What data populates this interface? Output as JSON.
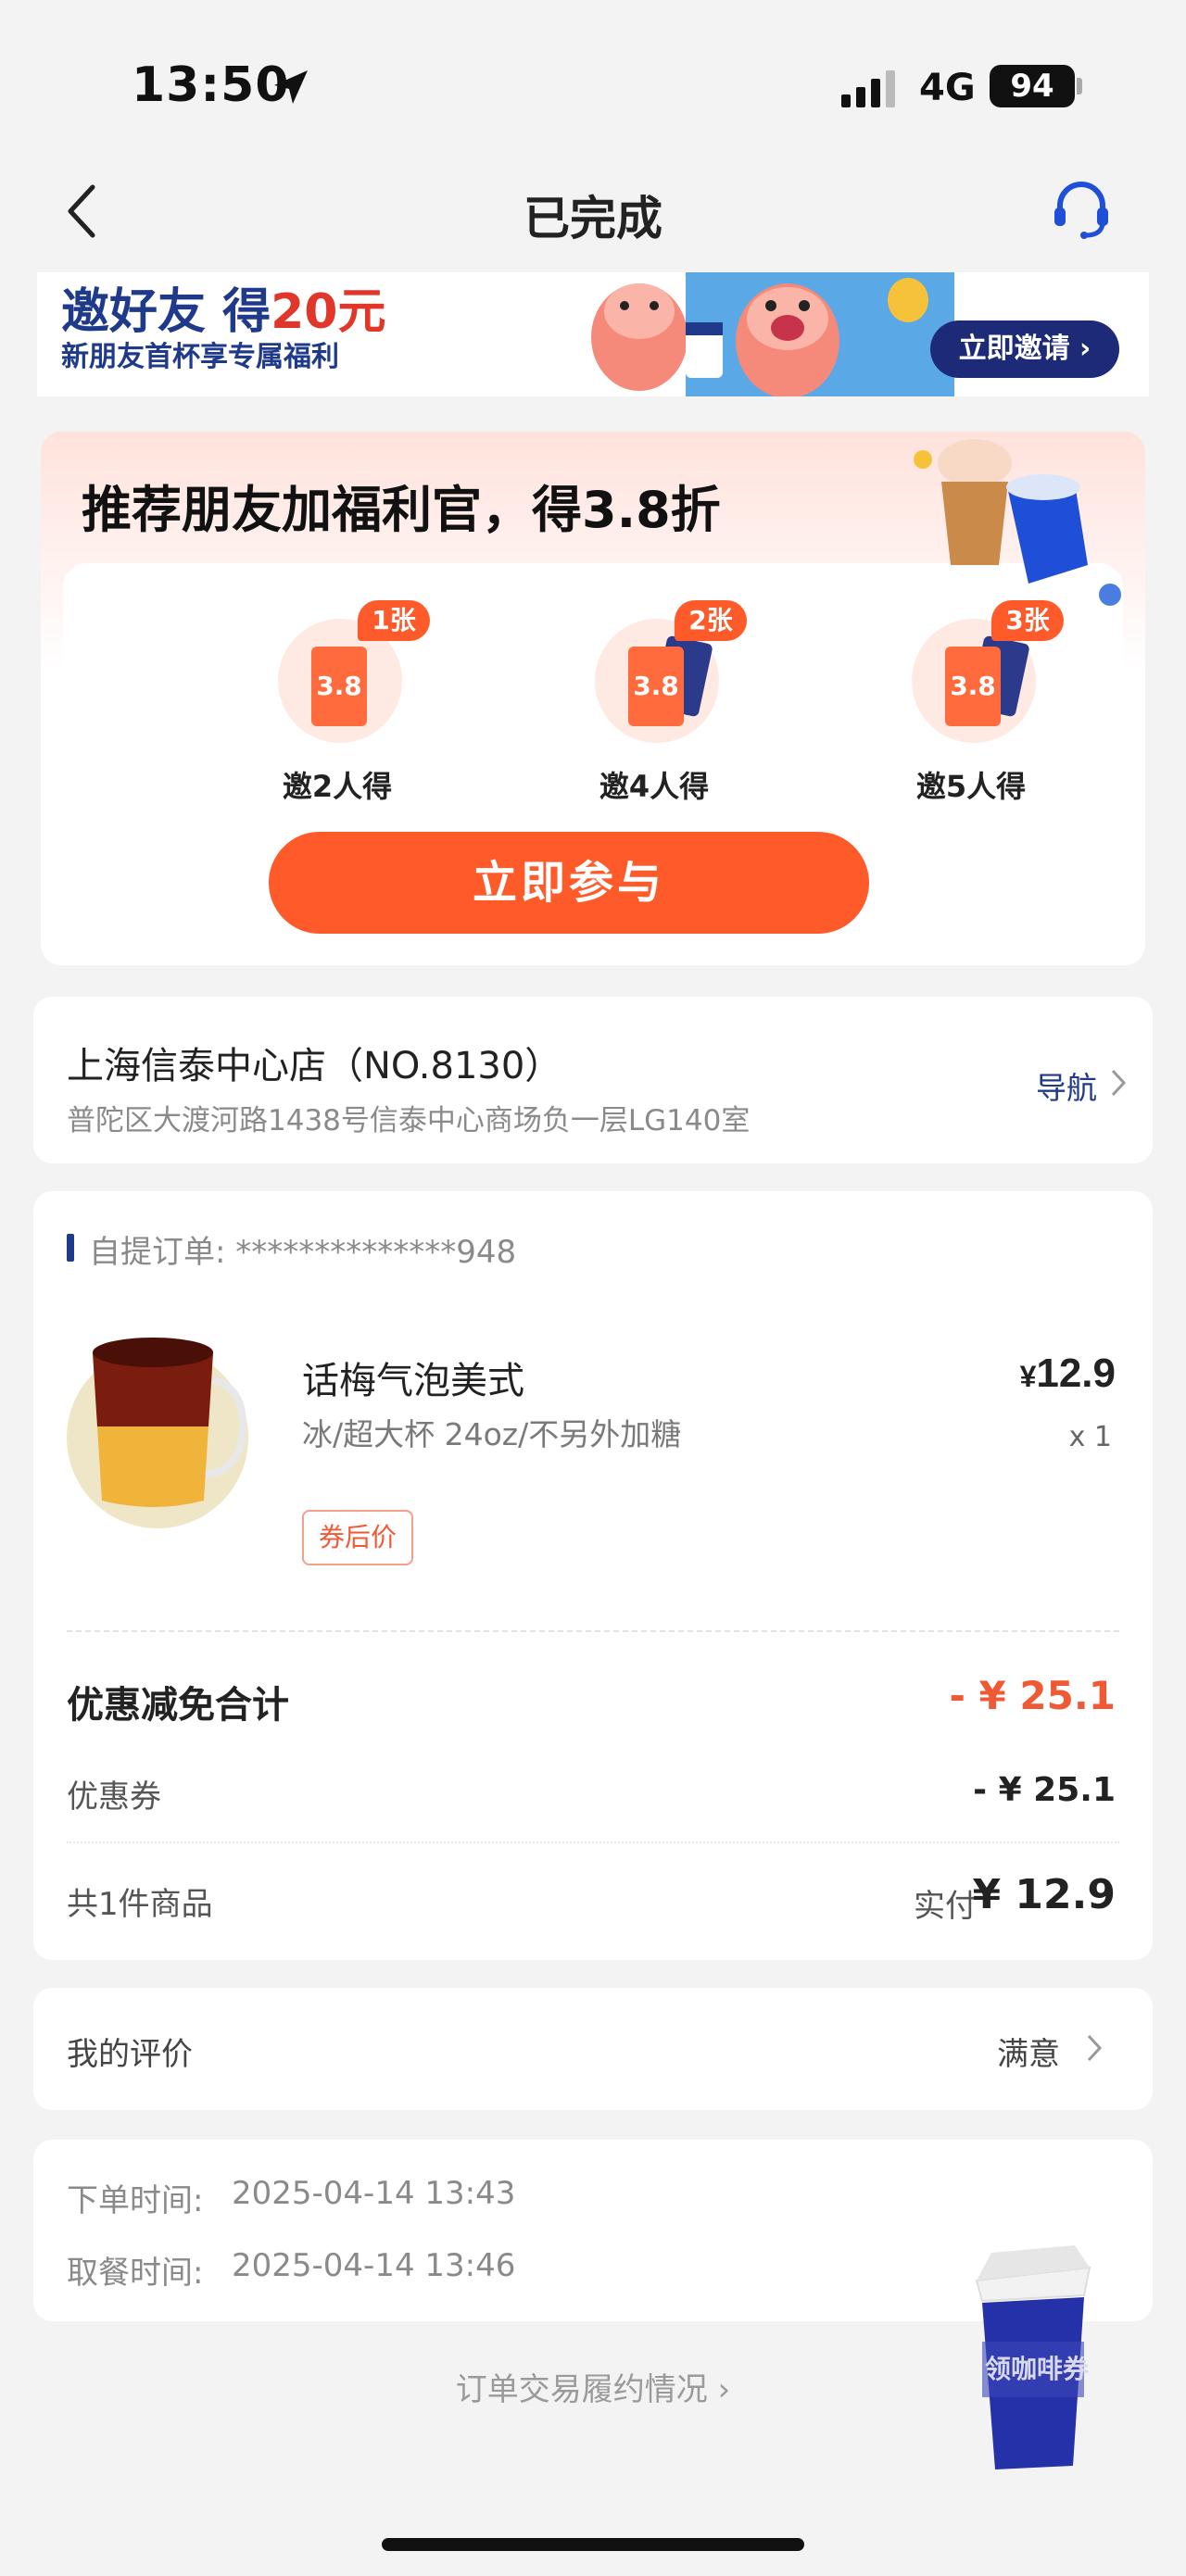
{
  "status_bar": {
    "time": "13:50",
    "network": "4G",
    "battery": "94"
  },
  "nav": {
    "title": "已完成"
  },
  "top_banner": {
    "headline_prefix": "邀好友 得",
    "headline_amount": "20元",
    "subtitle": "新朋友首杯享专属福利",
    "button": "立即邀请"
  },
  "referral": {
    "title": "推荐朋友加福利官，得3.8折",
    "ticket_value": "3.8",
    "tiers": [
      {
        "badge": "1张",
        "label": "邀2人得"
      },
      {
        "badge": "2张",
        "label": "邀4人得"
      },
      {
        "badge": "3张",
        "label": "邀5人得"
      }
    ],
    "button": "立即参与"
  },
  "store": {
    "name": "上海信泰中心店（NO.8130）",
    "address": "普陀区大渡河路1438号信泰中心商场负一层LG140室",
    "nav_link": "导航"
  },
  "order": {
    "label": "自提订单: **************948",
    "product": {
      "name": "话梅气泡美式",
      "options": "冰/超大杯 24oz/不另外加糖",
      "tag": "券后价",
      "currency": "¥",
      "price": "12.9",
      "qty": "x 1"
    },
    "discount_total_label": "优惠减免合计",
    "discount_total_value": "- ¥ 25.1",
    "coupon_label": "优惠券",
    "coupon_value": "- ¥ 25.1",
    "count_label": "共1件商品",
    "paid_label": "实付",
    "paid_value": "¥ 12.9"
  },
  "review": {
    "label": "我的评价",
    "value": "满意"
  },
  "times": {
    "order_label": "下单时间:",
    "order_time": "2025-04-14 13:43",
    "pickup_label": "取餐时间:",
    "pickup_time": "2025-04-14 13:46"
  },
  "fulfillment_link": "订单交易履约情况 ›",
  "floating_coupon": "领咖啡券",
  "colors": {
    "accent": "#ff5a2a",
    "brand": "#1f3a8a",
    "discount": "#ef5a34"
  }
}
